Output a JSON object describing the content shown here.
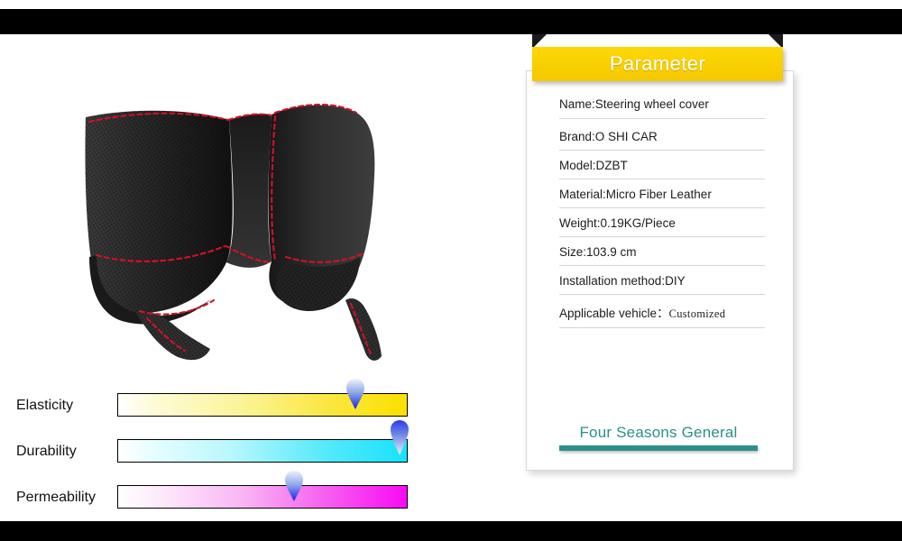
{
  "product_image": {
    "alt": "Black perforated micro fiber leather steering wheel cover with red stitching"
  },
  "parameter_panel": {
    "banner_title": "Parameter",
    "rows": [
      {
        "label": "Name:Steering wheel cover",
        "mono": false
      },
      {
        "label": "Brand:O SHI CAR",
        "mono": false
      },
      {
        "label": "Model:DZBT",
        "mono": false
      },
      {
        "label": "Material:Micro Fiber Leather",
        "mono": false
      },
      {
        "label": "Weight:0.19KG/Piece",
        "mono": false
      },
      {
        "label": "Size:103.9 cm",
        "mono": false
      },
      {
        "label": "Installation method:DIY",
        "mono": false
      },
      {
        "label": "Applicable vehicle：",
        "value": "Customized",
        "mono": true
      }
    ],
    "footer_text": "Four Seasons General",
    "accent_color": "#2b9088",
    "banner_color": "#fbd404"
  },
  "attributes": [
    {
      "label": "Elasticity",
      "marker_percent": 82,
      "gradient_end": "#fbe000"
    },
    {
      "label": "Durability",
      "marker_percent": 97,
      "gradient_end": "#18e2fb"
    },
    {
      "label": "Permeability",
      "marker_percent": 61,
      "gradient_end": "#f90af5"
    }
  ]
}
